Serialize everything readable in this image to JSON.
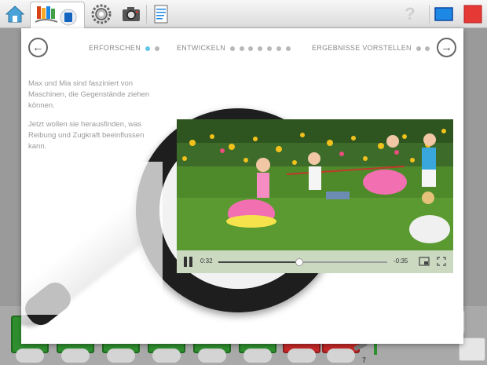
{
  "toolbar": {
    "items": [
      {
        "name": "home-icon"
      },
      {
        "name": "books-icon"
      },
      {
        "name": "gear-icon"
      },
      {
        "name": "camera-icon"
      },
      {
        "name": "notes-icon"
      },
      {
        "name": "help-icon",
        "glyph": "?"
      },
      {
        "name": "screen-icon"
      },
      {
        "name": "red-square-icon"
      }
    ]
  },
  "steps": {
    "prev_glyph": "←",
    "next_glyph": "→",
    "items": [
      {
        "label": "ERFORSCHEN",
        "dots": 2,
        "active_dot": 0
      },
      {
        "label": "ENTWICKELN",
        "dots": 7,
        "active_dot": -1
      },
      {
        "label": "ERGEBNISSE VORSTELLEN",
        "dots": 2,
        "active_dot": -1
      }
    ]
  },
  "story": {
    "paragraph1": "Max und Mia sind fasziniert von Maschinen, die Gegenstände ziehen können.",
    "paragraph2": "Jetzt wollen sie herausfinden, was Reibung und Zugkraft beeinflussen kann."
  },
  "video": {
    "time_elapsed": "0:32",
    "time_remaining": "-0:35",
    "progress": 0.48
  },
  "background": {
    "page_number": "7"
  },
  "colors": {
    "accent_dot": "#5fc7e6",
    "green_tile": "#2f8f2f",
    "red_tile": "#c62828"
  }
}
